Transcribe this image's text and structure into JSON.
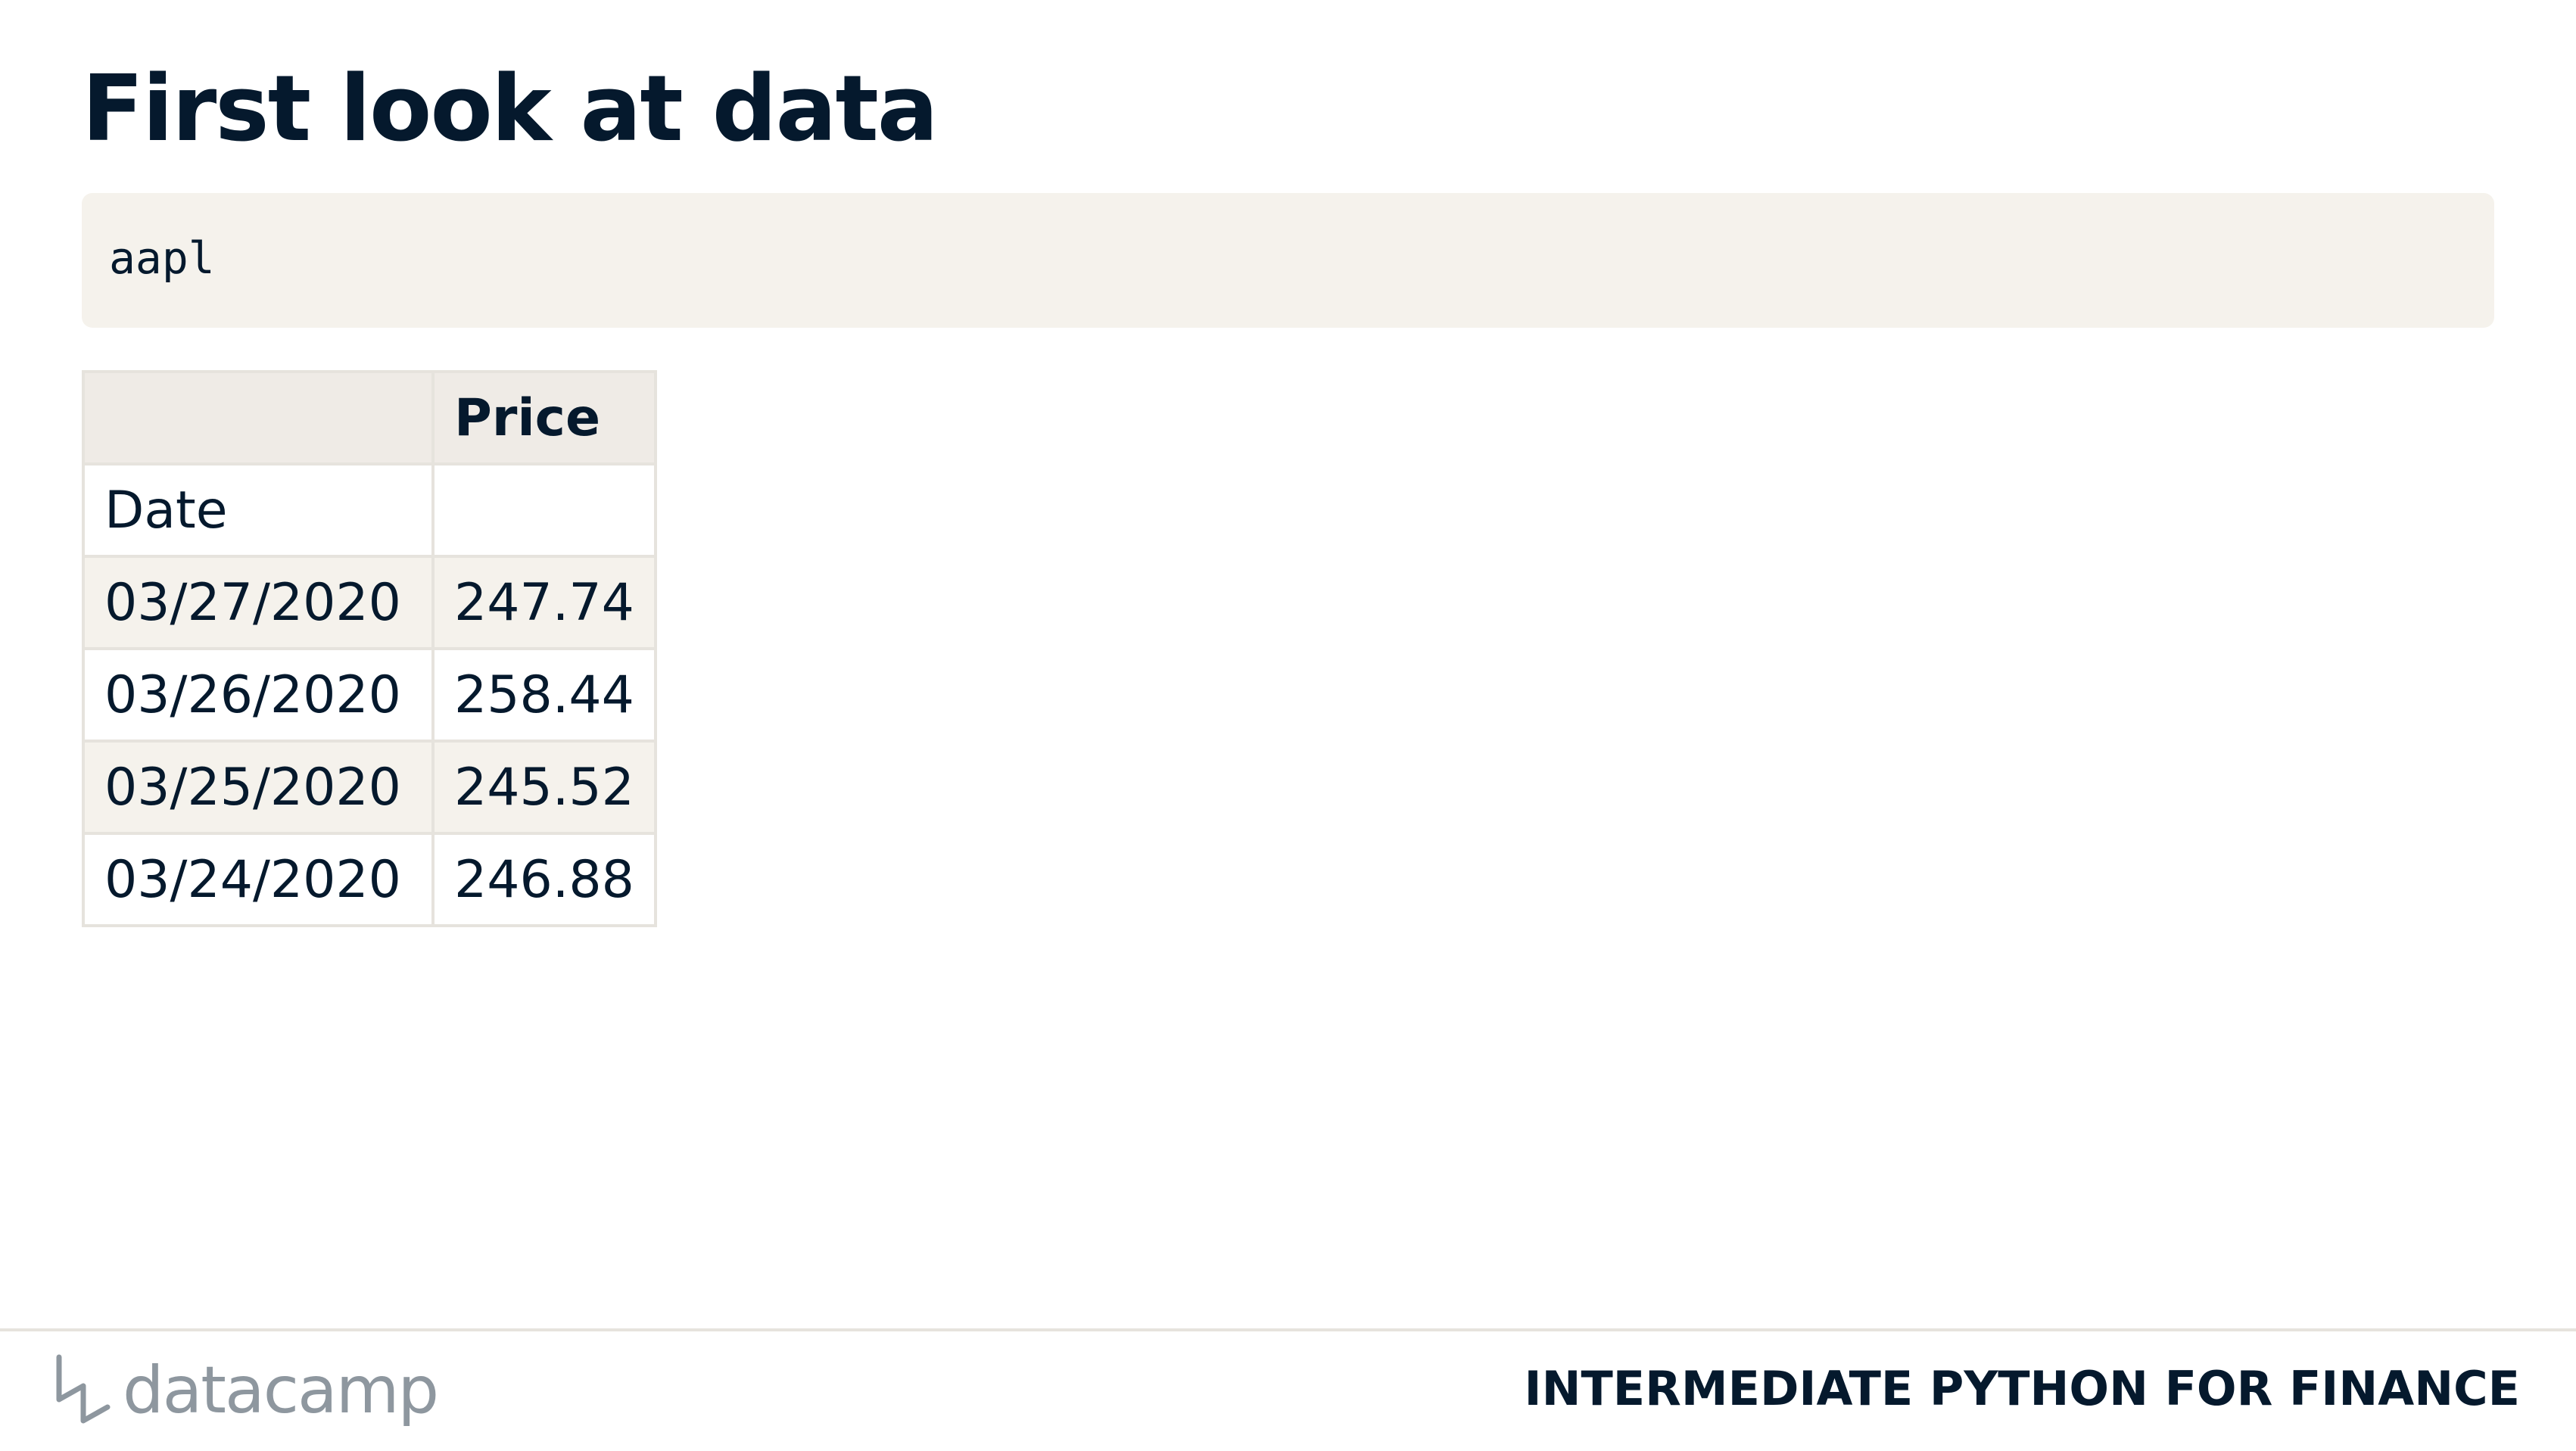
{
  "slide": {
    "title": "First look at data"
  },
  "code": {
    "text": "aapl"
  },
  "table": {
    "header": [
      "",
      "Price"
    ],
    "index_name": "Date",
    "rows": [
      {
        "date": "03/27/2020",
        "price": "247.74"
      },
      {
        "date": "03/26/2020",
        "price": "258.44"
      },
      {
        "date": "03/25/2020",
        "price": "245.52"
      },
      {
        "date": "03/24/2020",
        "price": "246.88"
      }
    ]
  },
  "footer": {
    "logo_text": "datacamp",
    "logo_icon": "datacamp-logo-icon",
    "course_title": "INTERMEDIATE PYTHON FOR FINANCE"
  },
  "colors": {
    "text": "#05192d",
    "code_background": "#f5f2ec",
    "table_header_background": "#efebe6",
    "table_border": "#e6e3dd",
    "logo": "#8e979f"
  }
}
